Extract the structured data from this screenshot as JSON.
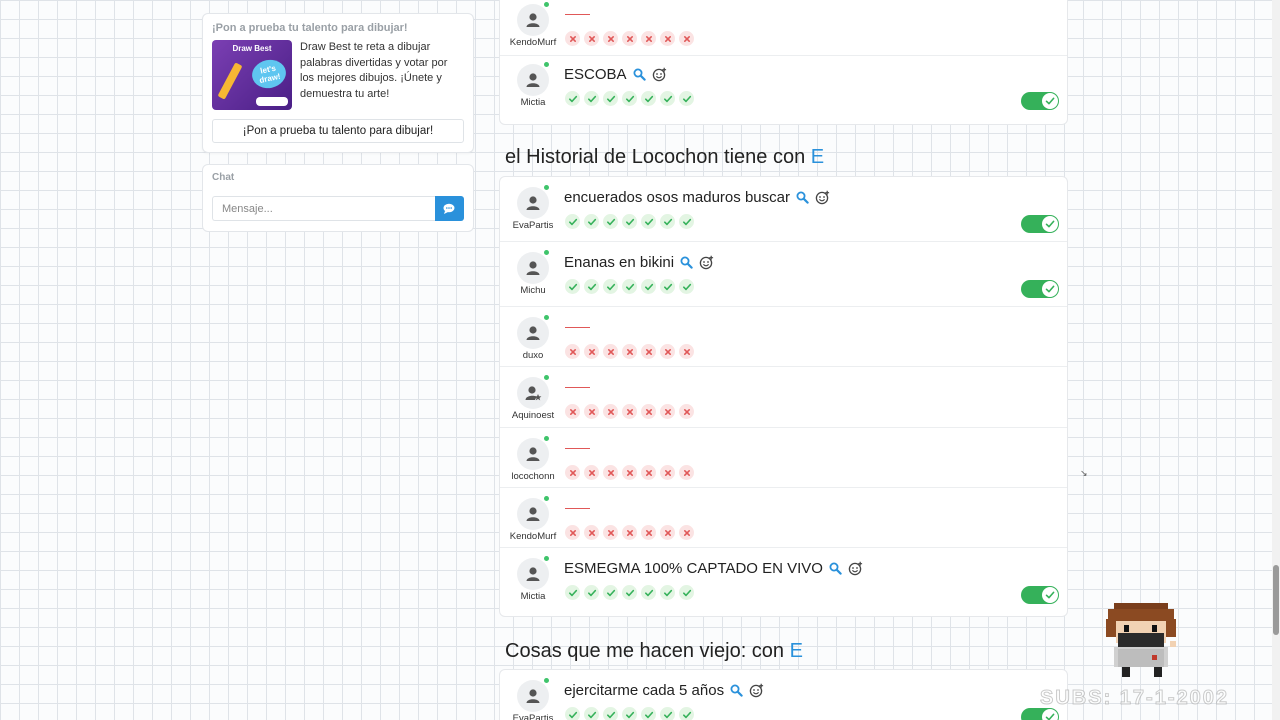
{
  "promo": {
    "title": "¡Pon a prueba tu talento para dibujar!",
    "image_brand": "Draw Best",
    "image_splash_line1": "let's",
    "image_splash_line2": "draw!",
    "description": "Draw Best te reta a dibujar palabras divertidas y votar por los mejores dibujos. ¡Únete y demuestra tu arte!",
    "button_label": "¡Pon a prueba tu talento para dibujar!"
  },
  "chat": {
    "title": "Chat",
    "placeholder": "Mensaje..."
  },
  "colors": {
    "accent": "#2a91db",
    "online": "#3fc46b",
    "toggle_on": "#35b15a",
    "vote_ok": "#35b15a",
    "vote_no": "#e05858"
  },
  "card_top": {
    "rows": [
      {
        "user": "KendoMurf",
        "answer": "",
        "votes": [
          "no",
          "no",
          "no",
          "no",
          "no",
          "no",
          "no"
        ],
        "toggle": false
      },
      {
        "user": "Mictia",
        "answer": "ESCOBA",
        "votes": [
          "ok",
          "ok",
          "ok",
          "ok",
          "ok",
          "ok",
          "ok"
        ],
        "toggle": true
      }
    ]
  },
  "section1": {
    "title_prefix": "el Historial de Locochon tiene con",
    "letter": "E",
    "rows": [
      {
        "user": "EvaPartis",
        "answer": "encuerados osos maduros buscar",
        "votes": [
          "ok",
          "ok",
          "ok",
          "ok",
          "ok",
          "ok",
          "ok"
        ],
        "toggle": true
      },
      {
        "user": "Michu",
        "answer": "Enanas en bikini",
        "votes": [
          "ok",
          "ok",
          "ok",
          "ok",
          "ok",
          "ok",
          "ok"
        ],
        "toggle": true
      },
      {
        "user": "duxo",
        "answer": "",
        "votes": [
          "no",
          "no",
          "no",
          "no",
          "no",
          "no",
          "no"
        ],
        "toggle": false
      },
      {
        "user": "Aquinoest",
        "answer": "",
        "votes": [
          "no",
          "no",
          "no",
          "no",
          "no",
          "no",
          "no"
        ],
        "toggle": false,
        "star_avatar": true
      },
      {
        "user": "locochonn",
        "answer": "",
        "votes": [
          "no",
          "no",
          "no",
          "no",
          "no",
          "no",
          "no"
        ],
        "toggle": false
      },
      {
        "user": "KendoMurf",
        "answer": "",
        "votes": [
          "no",
          "no",
          "no",
          "no",
          "no",
          "no",
          "no"
        ],
        "toggle": false
      },
      {
        "user": "Mictia",
        "answer": "ESMEGMA 100% CAPTADO EN VIVO",
        "votes": [
          "ok",
          "ok",
          "ok",
          "ok",
          "ok",
          "ok",
          "ok"
        ],
        "toggle": true
      }
    ]
  },
  "section2": {
    "title_prefix": "Cosas que me hacen viejo: con",
    "letter": "E",
    "rows": [
      {
        "user": "EvaPartis",
        "answer": "ejercitarme cada 5 años",
        "votes": [
          "ok",
          "ok",
          "ok",
          "ok",
          "ok",
          "ok",
          "ok"
        ],
        "toggle": true
      }
    ]
  },
  "overlay": {
    "watermark": "SUBS: 17-1-2002"
  }
}
